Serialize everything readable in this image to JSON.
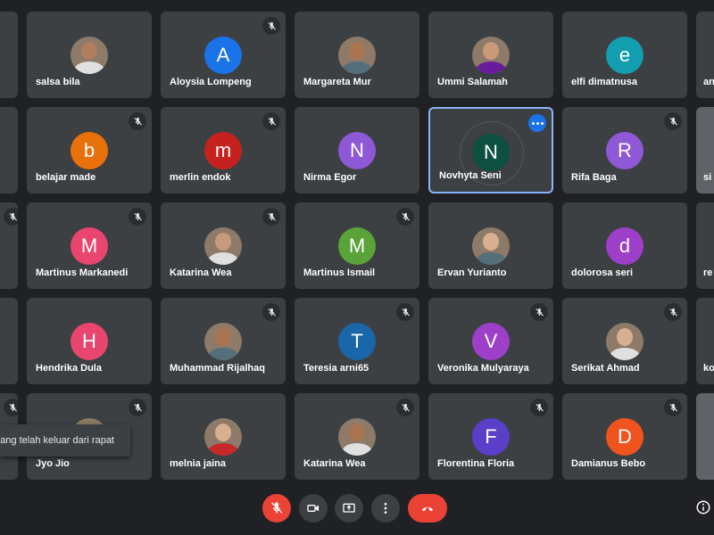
{
  "colors": {
    "background": "#202124",
    "tile": "#3c4043",
    "active_border": "#8ab4f8",
    "danger": "#ea4335"
  },
  "participants": [
    {
      "name": "",
      "muted": false,
      "avatar": "photo"
    },
    {
      "name": "salsa bila",
      "muted": false,
      "avatar": "photo"
    },
    {
      "name": "Aloysia Lompeng",
      "muted": true,
      "initial": "A",
      "color": "#1a73e8"
    },
    {
      "name": "Margareta Mur",
      "muted": false,
      "avatar": "photo"
    },
    {
      "name": "Ummi Salamah",
      "muted": false,
      "avatar": "photo"
    },
    {
      "name": "elfi dimatnusa",
      "muted": false,
      "initial": "e",
      "color": "#129eaf"
    },
    {
      "name": "an",
      "muted": false,
      "avatar": "none"
    },
    {
      "name": "...",
      "muted": false,
      "avatar": "none"
    },
    {
      "name": "belajar made",
      "muted": true,
      "initial": "b",
      "color": "#e8710a"
    },
    {
      "name": "merlin endok",
      "muted": true,
      "initial": "m",
      "color": "#c5221f"
    },
    {
      "name": "Nirma Egor",
      "muted": false,
      "initial": "N",
      "color": "#8e58d6"
    },
    {
      "name": "Novhyta Seni",
      "muted": false,
      "initial": "N",
      "color": "#0b5040",
      "active": true
    },
    {
      "name": "Rifa Baga",
      "muted": true,
      "initial": "R",
      "color": "#8e58d6"
    },
    {
      "name": "si",
      "muted": false,
      "avatar": "video"
    },
    {
      "name": "",
      "muted": true,
      "avatar": "none"
    },
    {
      "name": "Martinus Markanedi",
      "muted": true,
      "initial": "M",
      "color": "#e8466f"
    },
    {
      "name": "Katarina Wea",
      "muted": true,
      "avatar": "photo"
    },
    {
      "name": "Martinus Ismail",
      "muted": true,
      "initial": "M",
      "color": "#5aa338"
    },
    {
      "name": "Ervan Yurianto",
      "muted": false,
      "avatar": "photo"
    },
    {
      "name": "dolorosa seri",
      "muted": false,
      "initial": "d",
      "color": "#9e3fc9"
    },
    {
      "name": "re",
      "muted": false,
      "avatar": "none"
    },
    {
      "name": "",
      "muted": false,
      "avatar": "none"
    },
    {
      "name": "Hendrika Dula",
      "muted": false,
      "initial": "H",
      "color": "#e8466f"
    },
    {
      "name": "Muhammad Rijalhaq",
      "muted": true,
      "avatar": "photo"
    },
    {
      "name": "Teresia arni65",
      "muted": true,
      "initial": "T",
      "color": "#1967a8"
    },
    {
      "name": "Veronika Mulyaraya",
      "muted": true,
      "initial": "V",
      "color": "#9e3fc9"
    },
    {
      "name": "Serikat Ahmad",
      "muted": true,
      "avatar": "photo"
    },
    {
      "name": "ko",
      "muted": true,
      "avatar": "none"
    },
    {
      "name": "",
      "muted": true,
      "avatar": "none"
    },
    {
      "name": "Jyo Jio",
      "muted": true,
      "avatar": "photo"
    },
    {
      "name": "melnia jaina",
      "muted": false,
      "avatar": "photo"
    },
    {
      "name": "Katarina Wea",
      "muted": true,
      "avatar": "photo"
    },
    {
      "name": "Florentina Floria",
      "muted": true,
      "initial": "F",
      "color": "#5a3fc9"
    },
    {
      "name": "Damianus Bebo",
      "muted": true,
      "initial": "D",
      "color": "#f0541e"
    },
    {
      "name": "",
      "muted": false,
      "avatar": "video"
    }
  ],
  "toast": {
    "text": "ang telah keluar dari rapat"
  },
  "controls": [
    {
      "id": "mic",
      "icon": "mic-off-icon"
    },
    {
      "id": "camera",
      "icon": "camera-icon"
    },
    {
      "id": "present",
      "icon": "present-screen-icon"
    },
    {
      "id": "more",
      "icon": "more-vert-icon"
    },
    {
      "id": "leave",
      "icon": "hang-up-icon"
    }
  ]
}
